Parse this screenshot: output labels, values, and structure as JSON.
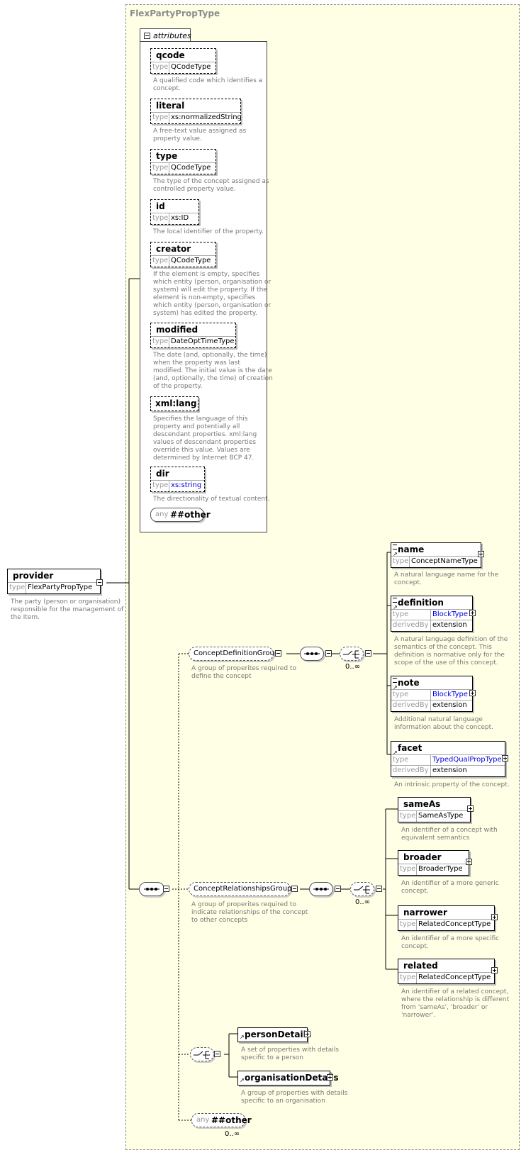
{
  "type_name": "FlexPartyPropType",
  "attributes_label": "attributes",
  "type_key": "type",
  "derived_key": "derivedBy",
  "any_key": "any",
  "attributes": [
    {
      "name": "qcode",
      "type": "QCodeType",
      "desc": [
        "A qualified code which identifies a",
        "concept."
      ]
    },
    {
      "name": "literal",
      "type": "xs:normalizedString",
      "desc": [
        "A free-text value assigned as",
        "property value."
      ]
    },
    {
      "name": "type",
      "type": "QCodeType",
      "desc": [
        "The type of the concept assigned as",
        "controlled property value."
      ]
    },
    {
      "name": "id",
      "type": "xs:ID",
      "desc": [
        "The local identifier of the property."
      ]
    },
    {
      "name": "creator",
      "type": "QCodeType",
      "desc": [
        "If the element is empty, specifies",
        "which entity (person, organisation or",
        "system) will edit the property. If the",
        "element is non-empty, specifies",
        "which entity (person, organisation or",
        "system) has edited the property."
      ]
    },
    {
      "name": "modified",
      "type": "DateOptTimeType",
      "desc": [
        "The date (and, optionally, the time)",
        "when the property was last",
        "modified. The initial value is the date",
        "(and, optionally, the time) of creation",
        "of the property."
      ]
    },
    {
      "name": "xml:lang",
      "desc": [
        "Specifies the language of this",
        "property and potentially all",
        "descendant properties. xml:lang",
        "values of descendant properties",
        "override this value. Values are",
        "determined by Internet BCP 47."
      ]
    },
    {
      "name": "dir",
      "type": "xs:string",
      "desc": [
        "The directionality of textual content."
      ]
    }
  ],
  "attr_any": "##other",
  "provider": {
    "name": "provider",
    "type": "FlexPartyPropType",
    "desc": [
      "The party (person or organisation)",
      "responsible for the management of",
      "the Item."
    ]
  },
  "groups": {
    "concept_definition": {
      "name": "ConceptDefinitionGroup",
      "desc": [
        "A group of properites required to",
        "define the concept"
      ]
    },
    "concept_relationships": {
      "name": "ConceptRelationshipsGroup",
      "desc": [
        "A group of properites required to",
        "indicate relationships of the concept",
        "to other concepts"
      ]
    }
  },
  "occurrence": "0..∞",
  "definition_elements": [
    {
      "name": "name",
      "type": "ConceptNameType",
      "desc": [
        "A natural language name for the",
        "concept."
      ]
    },
    {
      "name": "definition",
      "type": "BlockType",
      "derived": "extension",
      "desc": [
        "A natural language definition of the",
        "semantics of the concept. This",
        "definition is normative only for the",
        "scope of the use of this concept."
      ]
    },
    {
      "name": "note",
      "type": "BlockType",
      "derived": "extension",
      "desc": [
        "Additional natural language",
        "information about the concept."
      ]
    },
    {
      "name": "facet",
      "type": "TypedQualPropType",
      "derived": "extension",
      "desc": [
        "An intrinsic property of the concept."
      ]
    }
  ],
  "relationship_elements": [
    {
      "name": "sameAs",
      "type": "SameAsType",
      "desc": [
        "An identifier of a concept with",
        "equivalent semantics"
      ]
    },
    {
      "name": "broader",
      "type": "BroaderType",
      "desc": [
        "An identifier of a more generic",
        "concept."
      ]
    },
    {
      "name": "narrower",
      "type": "RelatedConceptType",
      "desc": [
        "An identifier of a more specific",
        "concept."
      ]
    },
    {
      "name": "related",
      "type": "RelatedConceptType",
      "desc": [
        "An identifier of a related concept,",
        "where the relationship is different",
        "from 'sameAs', 'broader' or",
        "'narrower'."
      ]
    }
  ],
  "choice_elements": [
    {
      "name": "personDetails",
      "desc": [
        "A set of properties with details",
        "specific to a person"
      ]
    },
    {
      "name": "organisationDetails",
      "desc": [
        "A group of properties with details",
        "specific to an organisation"
      ]
    }
  ],
  "element_any": "##other",
  "colors": {
    "frame_bg": "#ffffe6",
    "link_blue": "#0000dd",
    "desc_gray": "#777777"
  }
}
